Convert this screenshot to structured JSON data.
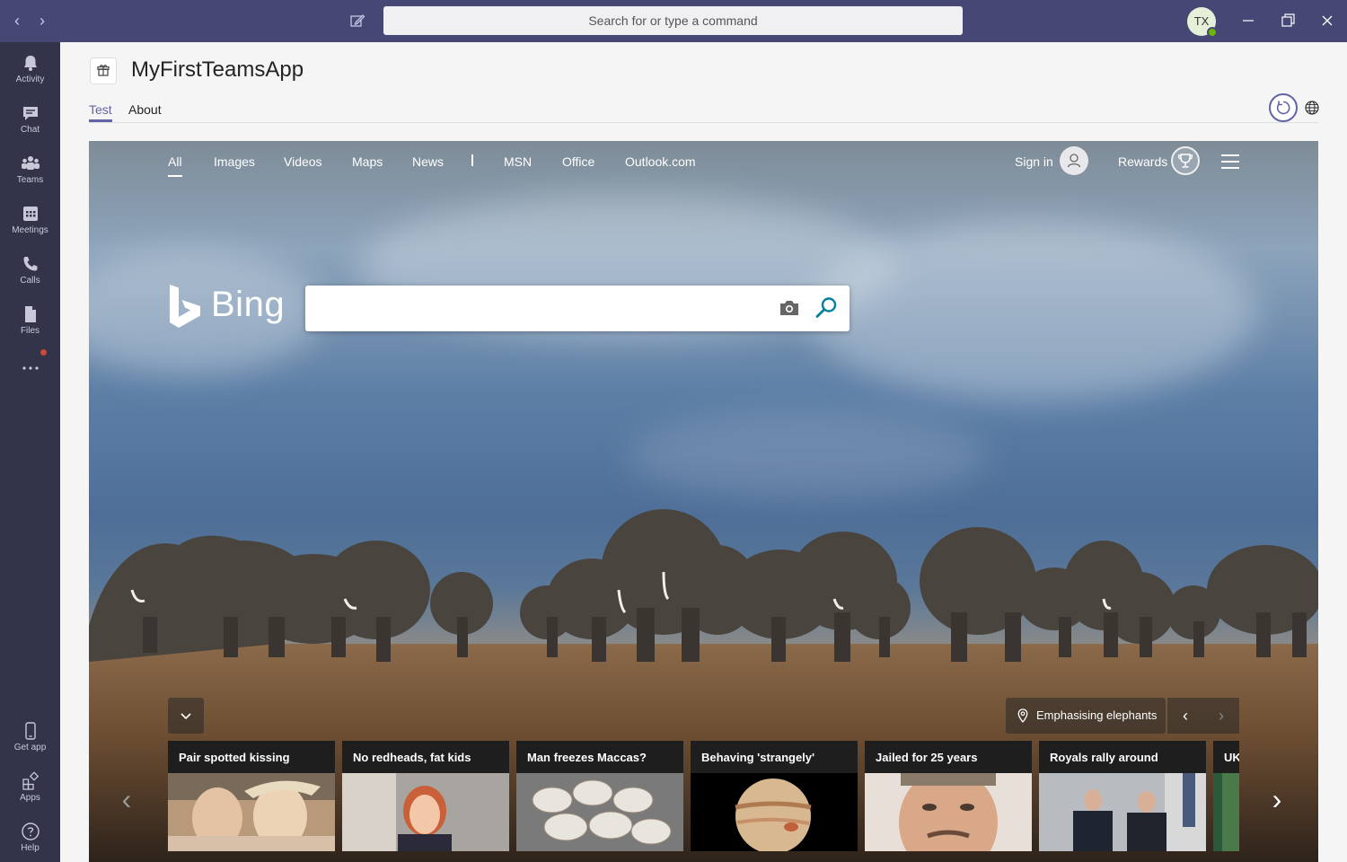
{
  "titlebar": {
    "command_placeholder": "Search for or type a command",
    "avatar_initials": "TX"
  },
  "rail": [
    {
      "label": "Activity",
      "icon": "bell-icon"
    },
    {
      "label": "Chat",
      "icon": "chat-icon"
    },
    {
      "label": "Teams",
      "icon": "teams-icon"
    },
    {
      "label": "Meetings",
      "icon": "calendar-icon"
    },
    {
      "label": "Calls",
      "icon": "phone-icon"
    },
    {
      "label": "Files",
      "icon": "file-icon"
    },
    {
      "label": "Get app",
      "icon": "device-icon"
    },
    {
      "label": "Apps",
      "icon": "apps-icon"
    },
    {
      "label": "Help",
      "icon": "help-icon"
    }
  ],
  "app": {
    "title": "MyFirstTeamsApp",
    "tabs": [
      {
        "label": "Test",
        "active": true
      },
      {
        "label": "About",
        "active": false
      }
    ]
  },
  "bing": {
    "nav": [
      "All",
      "Images",
      "Videos",
      "Maps",
      "News",
      "MSN",
      "Office",
      "Outlook.com"
    ],
    "active_nav": "All",
    "sign_in": "Sign in",
    "rewards": "Rewards",
    "wordmark": "Bing",
    "search_value": "",
    "location_label": "Emphasising elephants",
    "news": [
      {
        "title": "Pair spotted kissing"
      },
      {
        "title": "No redheads, fat kids"
      },
      {
        "title": "Man freezes Maccas?"
      },
      {
        "title": "Behaving 'strangely'"
      },
      {
        "title": "Jailed for 25 years"
      },
      {
        "title": "Royals rally around"
      },
      {
        "title": "UK"
      }
    ]
  },
  "colors": {
    "teams_purple": "#6264a7",
    "titlebar": "#464775",
    "rail": "#33344a",
    "presence": "#6bb700",
    "notification": "#cc4a31",
    "bing_teal": "#00809d"
  }
}
